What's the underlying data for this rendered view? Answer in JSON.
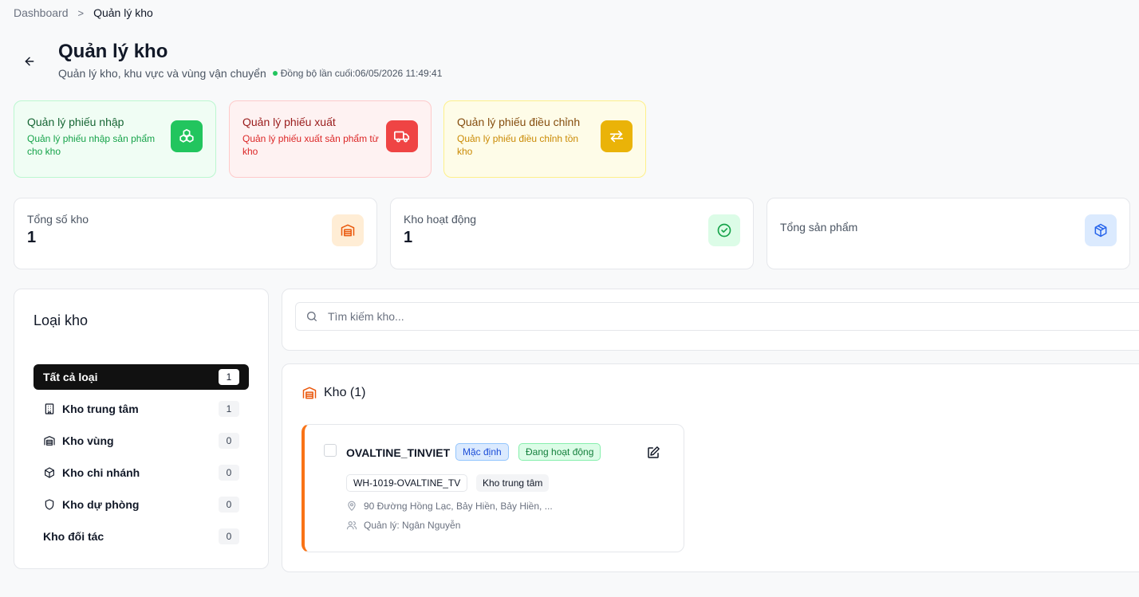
{
  "breadcrumb": {
    "root": "Dashboard",
    "separator": ">",
    "current": "Quản lý kho"
  },
  "header": {
    "title": "Quản lý kho",
    "subtitle": "Quản lý kho, khu vực và vùng vận chuyển",
    "sync_label": "Đồng bộ lần cuối:06/05/2026 11:49:41"
  },
  "action_cards": [
    {
      "title": "Quản lý phiếu nhập",
      "desc": "Quản lý phiếu nhập sản phẩm cho kho",
      "icon": "boxes-icon",
      "color": "#22c55e"
    },
    {
      "title": "Quản lý phiếu xuất",
      "desc": "Quản lý phiếu xuất sản phẩm từ kho",
      "icon": "truck-icon",
      "color": "#ef4444"
    },
    {
      "title": "Quản lý phiếu điều chỉnh",
      "desc": "Quản lý phiếu điều chỉnh tồn kho",
      "icon": "swap-arrows-icon",
      "color": "#eab308"
    }
  ],
  "stats": [
    {
      "label": "Tổng số kho",
      "value": "1",
      "icon": "warehouse-icon"
    },
    {
      "label": "Kho hoạt động",
      "value": "1",
      "icon": "check-circle-icon"
    },
    {
      "label": "Tổng sản phẩm",
      "value": "",
      "icon": "package-icon"
    }
  ],
  "sidebar": {
    "title": "Loại kho",
    "items": [
      {
        "label": "Tất cả loại",
        "count": "1",
        "active": true
      },
      {
        "label": "Kho trung tâm",
        "count": "1",
        "icon": "building-icon"
      },
      {
        "label": "Kho vùng",
        "count": "0",
        "icon": "warehouse-icon"
      },
      {
        "label": "Kho chi nhánh",
        "count": "0",
        "icon": "package-icon"
      },
      {
        "label": "Kho dự phòng",
        "count": "0",
        "icon": "shield-icon"
      },
      {
        "label": "Kho đối tác",
        "count": "0"
      }
    ]
  },
  "search": {
    "placeholder": "Tìm kiếm kho..."
  },
  "warehouse_list": {
    "title": "Kho (1)",
    "items": [
      {
        "name": "OVALTINE_TINVIET",
        "badge_default": "Mặc định",
        "badge_status": "Đang hoạt động",
        "code": "WH-1019-OVALTINE_TV",
        "type": "Kho trung tâm",
        "address": "90 Đường Hồng Lạc, Bảy Hiền, Bảy Hiền, ...",
        "manager": "Quản lý: Ngân Nguyễn"
      }
    ]
  },
  "colors": {
    "accent_orange": "#f97316",
    "active_dark": "#111111",
    "sync_green": "#22c55e"
  }
}
